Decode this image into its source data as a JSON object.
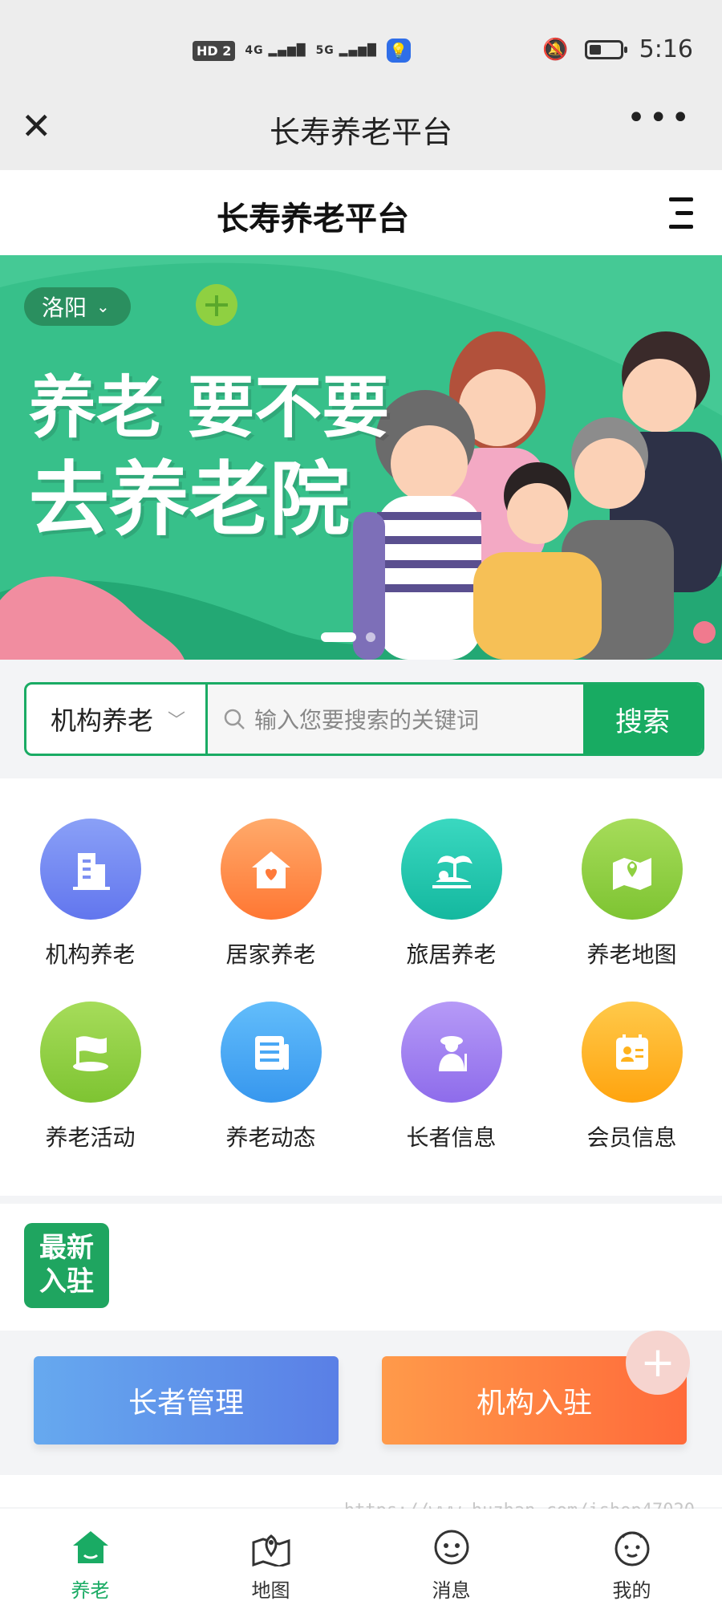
{
  "status_bar": {
    "hd": "HD 2",
    "signal_1": "4G",
    "signal_2": "5G",
    "time": "5:16"
  },
  "window": {
    "title": "长寿养老平台",
    "close_glyph": "✕",
    "more_glyph": "•••"
  },
  "header": {
    "title": "长寿养老平台"
  },
  "banner": {
    "city": "洛阳",
    "line1": "养老 要不要",
    "line2": "去养老院",
    "slide_count": 3,
    "active_slide": 1
  },
  "search": {
    "type": "机构养老",
    "placeholder": "输入您要搜索的关键词",
    "button": "搜索"
  },
  "categories": [
    {
      "label": "机构养老",
      "icon": "building-icon",
      "color": "#6b82f2"
    },
    {
      "label": "居家养老",
      "icon": "home-heart-icon",
      "color": "#ff8a3d"
    },
    {
      "label": "旅居养老",
      "icon": "island-icon",
      "color": "#25c7b0"
    },
    {
      "label": "养老地图",
      "icon": "map-pin-icon",
      "color": "#8fd041"
    },
    {
      "label": "养老活动",
      "icon": "flag-icon",
      "color": "#8fd041"
    },
    {
      "label": "养老动态",
      "icon": "news-icon",
      "color": "#4aa8f5"
    },
    {
      "label": "长者信息",
      "icon": "elder-icon",
      "color": "#a07cf0"
    },
    {
      "label": "会员信息",
      "icon": "member-card-icon",
      "color": "#ffb21d"
    }
  ],
  "news": {
    "badge_line1": "最新",
    "badge_line2": "入驻"
  },
  "actions": {
    "elder_manage": "长者管理",
    "org_join": "机构入驻",
    "fab": "+"
  },
  "watermark": "https://www.huzhan.com/ishop47020",
  "tabs": [
    {
      "label": "养老",
      "icon": "home-icon",
      "active": true
    },
    {
      "label": "地图",
      "icon": "map-icon",
      "active": false
    },
    {
      "label": "消息",
      "icon": "message-icon",
      "active": false
    },
    {
      "label": "我的",
      "icon": "profile-icon",
      "active": false
    }
  ],
  "colors": {
    "brand_green": "#1aab64",
    "banner_green": "#37c08a"
  }
}
